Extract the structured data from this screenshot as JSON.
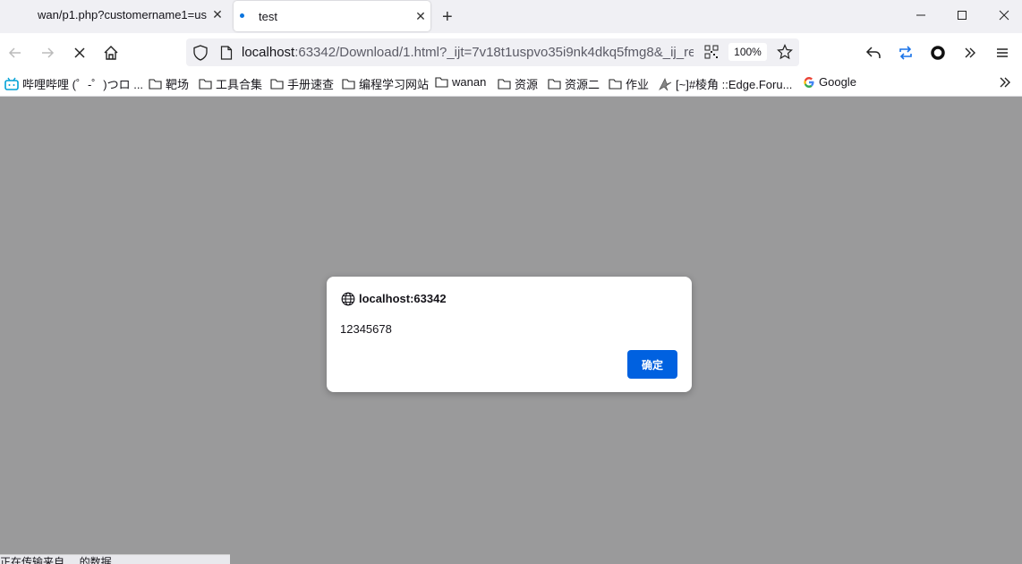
{
  "tabs": [
    {
      "title": "wan/p1.php?customername1=us",
      "close": "✕",
      "active": false
    },
    {
      "title": "test",
      "close": "✕",
      "active": true
    }
  ],
  "newtab_label": "+",
  "window_controls": {
    "minimize": "—",
    "maximize": "☐",
    "close": "✕"
  },
  "toolbar": {
    "url_host": "localhost",
    "url_rest": ":63342/Download/1.html?_ijt=7v18t1uspvo35i9nk4dkq5fmg8&_ij_re",
    "zoom": "100%"
  },
  "bookmarks": [
    {
      "label": "哔哩哔哩 (゜-゜)つロ ...",
      "icon": "bilibili-icon"
    },
    {
      "label": "靶场",
      "icon": "folder-icon"
    },
    {
      "label": "工具合集",
      "icon": "folder-icon"
    },
    {
      "label": "手册速查",
      "icon": "folder-icon"
    },
    {
      "label": "编程学习网站",
      "icon": "folder-icon"
    },
    {
      "label": "wanan",
      "icon": "folder-icon"
    },
    {
      "label": "资源",
      "icon": "folder-icon"
    },
    {
      "label": "资源二",
      "icon": "folder-icon"
    },
    {
      "label": "作业",
      "icon": "folder-icon"
    },
    {
      "label": "[~]#棱角 ::Edge.Foru...",
      "icon": "edge-forum-icon"
    },
    {
      "label": "Google",
      "icon": "google-icon"
    }
  ],
  "dialog": {
    "origin": "localhost:63342",
    "message": "12345678",
    "ok_label": "确定"
  },
  "status_text": "正在传输来自 ... 的数据",
  "colors": {
    "accent": "#0061e0",
    "overlay": "#9a9a9b"
  }
}
